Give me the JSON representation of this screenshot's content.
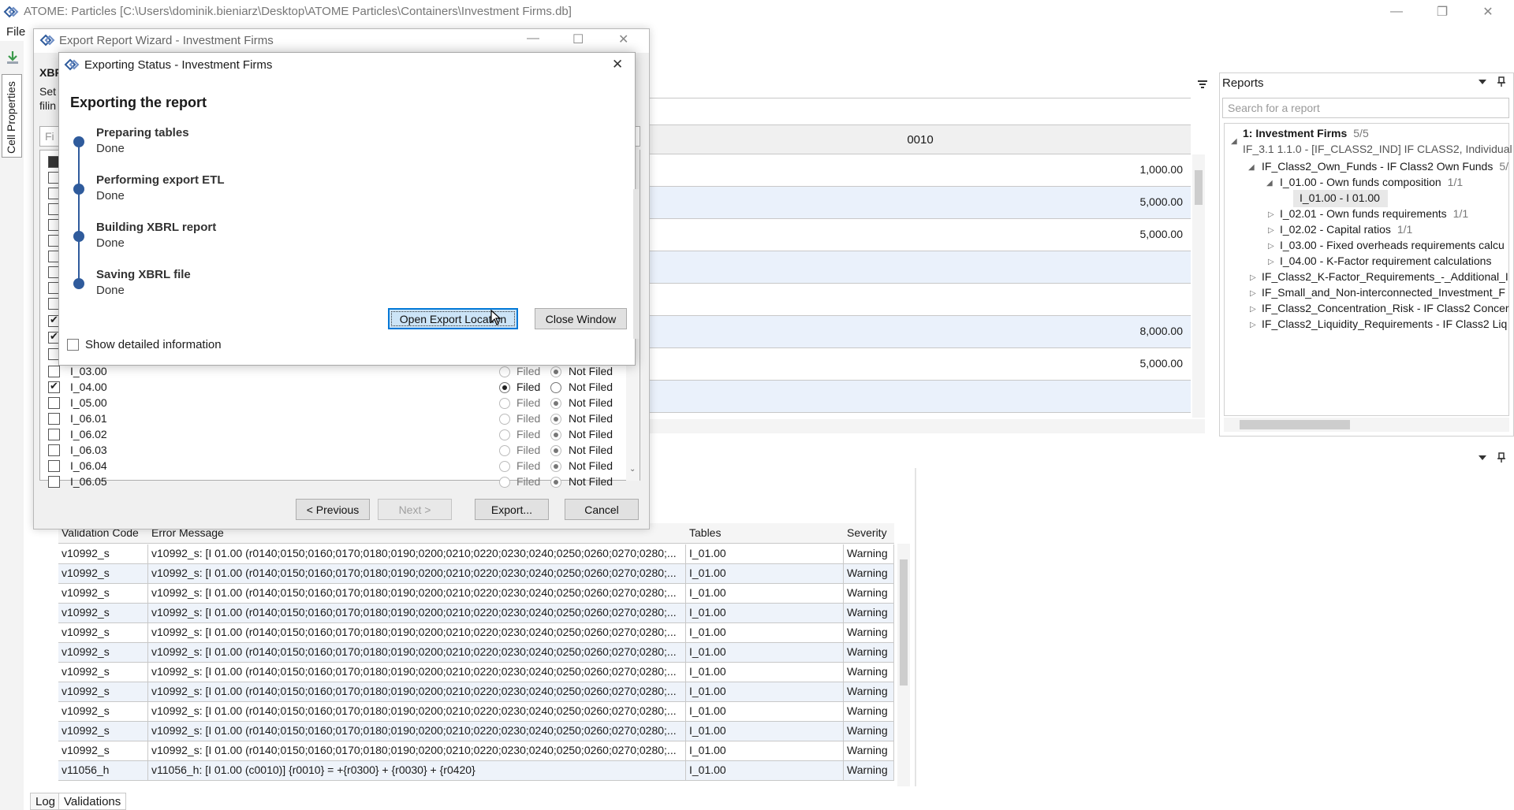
{
  "app": {
    "title": "ATOME: Particles [C:\\Users\\dominik.bieniarz\\Desktop\\ATOME Particles\\Containers\\Investment Firms.db]",
    "menu_file": "File",
    "cell_properties_tab": "Cell Properties"
  },
  "center_grid": {
    "column_header": "0010",
    "rows": [
      {
        "value": "1,000.00"
      },
      {
        "value": "5,000.00"
      },
      {
        "value": "5,000.00"
      },
      {
        "value": ""
      },
      {
        "value": ""
      },
      {
        "value": "8,000.00"
      },
      {
        "value": "5,000.00"
      },
      {
        "value": ""
      }
    ]
  },
  "reports": {
    "title": "Reports",
    "search_placeholder": "Search for a report",
    "tree": [
      {
        "label": "1: Investment Firms",
        "count": "5/5"
      },
      {
        "label": "IF_3.1 1.1.0 - [IF_CLASS2_IND] IF CLASS2, Individual"
      },
      {
        "label": "IF_Class2_Own_Funds - IF Class2 Own Funds",
        "count": "5/"
      },
      {
        "label": "I_01.00 - Own funds composition",
        "count": "1/1"
      },
      {
        "label": "I_01.00 - I 01.00"
      },
      {
        "label": "I_02.01 - Own funds requirements",
        "count": "1/1"
      },
      {
        "label": "I_02.02 - Capital ratios",
        "count": "1/1"
      },
      {
        "label": "I_03.00 - Fixed overheads requirements calcu"
      },
      {
        "label": "I_04.00 - K-Factor requirement calculations"
      },
      {
        "label": "IF_Class2_K-Factor_Requirements_-_Additional_I"
      },
      {
        "label": "IF_Small_and_Non-interconnected_Investment_F"
      },
      {
        "label": "IF_Class2_Concentration_Risk - IF Class2 Concer"
      },
      {
        "label": "IF_Class2_Liquidity_Requirements - IF Class2 Liq"
      }
    ]
  },
  "validations": {
    "headers": {
      "code": "Validation Code",
      "message": "Error Message",
      "tables": "Tables",
      "severity": "Severity"
    },
    "rows": [
      {
        "code": "v10992_s",
        "message": "v10992_s: [I 01.00 (r0140;0150;0160;0170;0180;0190;0200;0210;0220;0230;0240;0250;0260;0270;0280;...",
        "tables": "I_01.00",
        "severity": "Warning"
      },
      {
        "code": "v10992_s",
        "message": "v10992_s: [I 01.00 (r0140;0150;0160;0170;0180;0190;0200;0210;0220;0230;0240;0250;0260;0270;0280;...",
        "tables": "I_01.00",
        "severity": "Warning"
      },
      {
        "code": "v10992_s",
        "message": "v10992_s: [I 01.00 (r0140;0150;0160;0170;0180;0190;0200;0210;0220;0230;0240;0250;0260;0270;0280;...",
        "tables": "I_01.00",
        "severity": "Warning"
      },
      {
        "code": "v10992_s",
        "message": "v10992_s: [I 01.00 (r0140;0150;0160;0170;0180;0190;0200;0210;0220;0230;0240;0250;0260;0270;0280;...",
        "tables": "I_01.00",
        "severity": "Warning"
      },
      {
        "code": "v10992_s",
        "message": "v10992_s: [I 01.00 (r0140;0150;0160;0170;0180;0190;0200;0210;0220;0230;0240;0250;0260;0270;0280;...",
        "tables": "I_01.00",
        "severity": "Warning"
      },
      {
        "code": "v10992_s",
        "message": "v10992_s: [I 01.00 (r0140;0150;0160;0170;0180;0190;0200;0210;0220;0230;0240;0250;0260;0270;0280;...",
        "tables": "I_01.00",
        "severity": "Warning"
      },
      {
        "code": "v10992_s",
        "message": "v10992_s: [I 01.00 (r0140;0150;0160;0170;0180;0190;0200;0210;0220;0230;0240;0250;0260;0270;0280;...",
        "tables": "I_01.00",
        "severity": "Warning"
      },
      {
        "code": "v10992_s",
        "message": "v10992_s: [I 01.00 (r0140;0150;0160;0170;0180;0190;0200;0210;0220;0230;0240;0250;0260;0270;0280;...",
        "tables": "I_01.00",
        "severity": "Warning"
      },
      {
        "code": "v10992_s",
        "message": "v10992_s: [I 01.00 (r0140;0150;0160;0170;0180;0190;0200;0210;0220;0230;0240;0250;0260;0270;0280;...",
        "tables": "I_01.00",
        "severity": "Warning"
      },
      {
        "code": "v10992_s",
        "message": "v10992_s: [I 01.00 (r0140;0150;0160;0170;0180;0190;0200;0210;0220;0230;0240;0250;0260;0270;0280;...",
        "tables": "I_01.00",
        "severity": "Warning"
      },
      {
        "code": "v10992_s",
        "message": "v10992_s: [I 01.00 (r0140;0150;0160;0170;0180;0190;0200;0210;0220;0230;0240;0250;0260;0270;0280;...",
        "tables": "I_01.00",
        "severity": "Warning"
      },
      {
        "code": "v11056_h",
        "message": "v11056_h: [I 01.00 (c0010)] {r0010} = +{r0300} + {r0030} + {r0420}",
        "tables": "I_01.00",
        "severity": "Warning"
      }
    ],
    "tabs": {
      "log": "Log",
      "validations": "Validations"
    }
  },
  "wizard": {
    "title": "Export Report Wizard - Investment Firms",
    "body_heading": "XBRL",
    "body_line1": "Set",
    "body_line2": "filin",
    "search_placeholder": "Fi",
    "filed_label": "Filed",
    "not_filed_label": "Not Filed",
    "rows": [
      {
        "code": "I_03.00",
        "checked": false,
        "filed": false
      },
      {
        "code": "I_04.00",
        "checked": true,
        "filed": true
      },
      {
        "code": "I_05.00",
        "checked": false,
        "filed": false
      },
      {
        "code": "I_06.01",
        "checked": false,
        "filed": false
      },
      {
        "code": "I_06.02",
        "checked": false,
        "filed": false
      },
      {
        "code": "I_06.03",
        "checked": false,
        "filed": false
      },
      {
        "code": "I_06.04",
        "checked": false,
        "filed": false
      },
      {
        "code": "I_06.05",
        "checked": false,
        "filed": false
      }
    ],
    "buttons": {
      "previous": "< Previous",
      "next": "Next >",
      "export": "Export...",
      "cancel": "Cancel"
    }
  },
  "status_dialog": {
    "title": "Exporting Status - Investment Firms",
    "heading": "Exporting the report",
    "steps": [
      {
        "title": "Preparing tables",
        "status": "Done"
      },
      {
        "title": "Performing export ETL",
        "status": "Done"
      },
      {
        "title": "Building XBRL report",
        "status": "Done"
      },
      {
        "title": "Saving XBRL file",
        "status": "Done"
      }
    ],
    "open_location_button": "Open Export Location",
    "close_button": "Close Window",
    "detail_checkbox_label": "Show detailed information"
  },
  "colors": {
    "accent": "#2f5b9c",
    "row_alt": "#eaf1fb"
  }
}
